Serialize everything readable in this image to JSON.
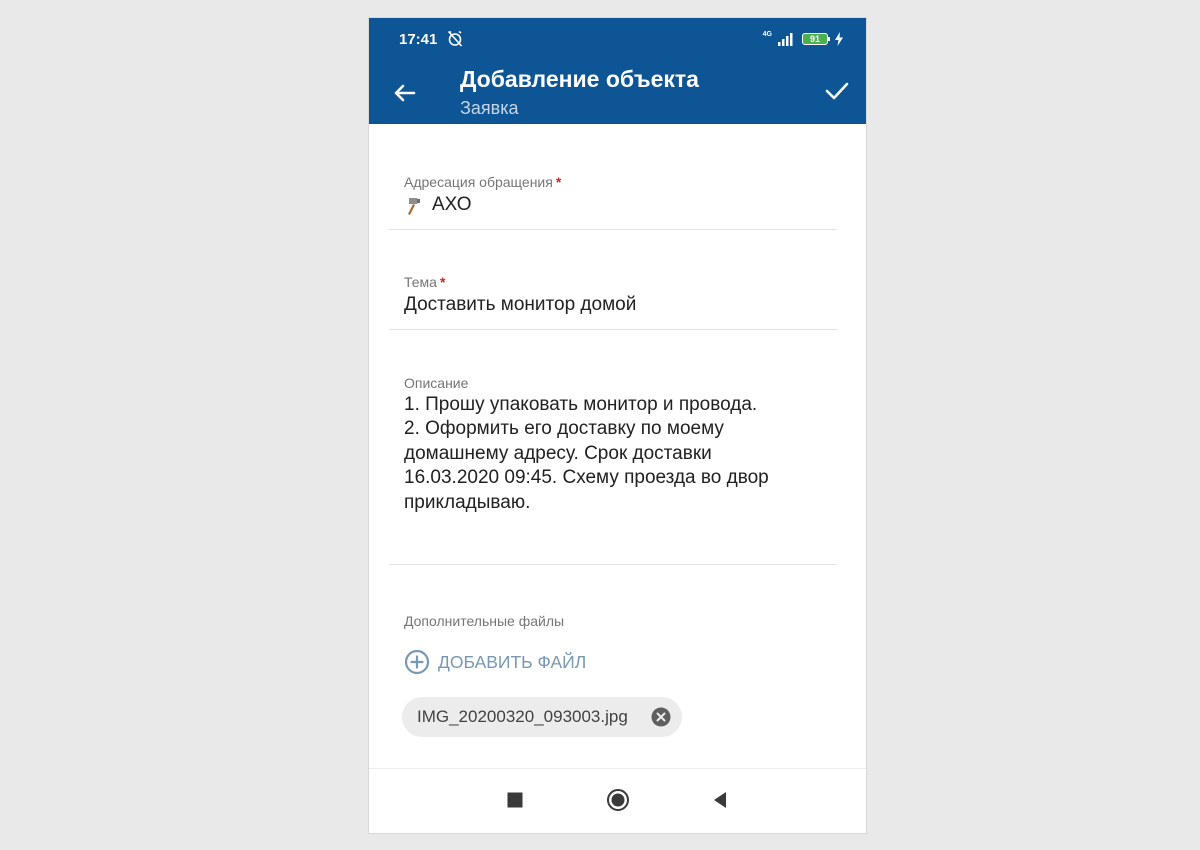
{
  "status_bar": {
    "time": "17:41",
    "network": "4G",
    "battery": "91",
    "icons": [
      "alarm-off-icon",
      "signal-icon",
      "battery-icon",
      "charging-icon"
    ]
  },
  "app_bar": {
    "title": "Добавление объекта",
    "subtitle": "Заявка",
    "back_icon": "arrow-back-icon",
    "confirm_icon": "check-icon"
  },
  "form": {
    "addressing": {
      "label": "Адресация обращения",
      "required_mark": "*",
      "value": "АХО",
      "value_icon": "hammer-icon"
    },
    "topic": {
      "label": "Тема",
      "required_mark": "*",
      "value": "Доставить монитор домой"
    },
    "description": {
      "label": "Описание",
      "lines": [
        "1. Прошу упаковать монитор и провода.",
        "2. Оформить его доставку по моему",
        "домашнему адресу. Срок доставки",
        "16.03.2020 09:45. Схему проезда во двор",
        "прикладываю."
      ]
    },
    "files": {
      "label": "Дополнительные файлы",
      "add_button": "ДОБАВИТЬ ФАЙЛ",
      "add_icon": "add-circle-icon",
      "attachments": [
        "IMG_20200320_093003.jpg"
      ]
    }
  },
  "nav_bar": {
    "buttons": [
      "recents-square-icon",
      "home-circle-icon",
      "back-triangle-icon"
    ]
  },
  "colors": {
    "primary": "#0d5594",
    "required": "#c62828",
    "link": "#7898b3",
    "battery": "#4caf50"
  }
}
